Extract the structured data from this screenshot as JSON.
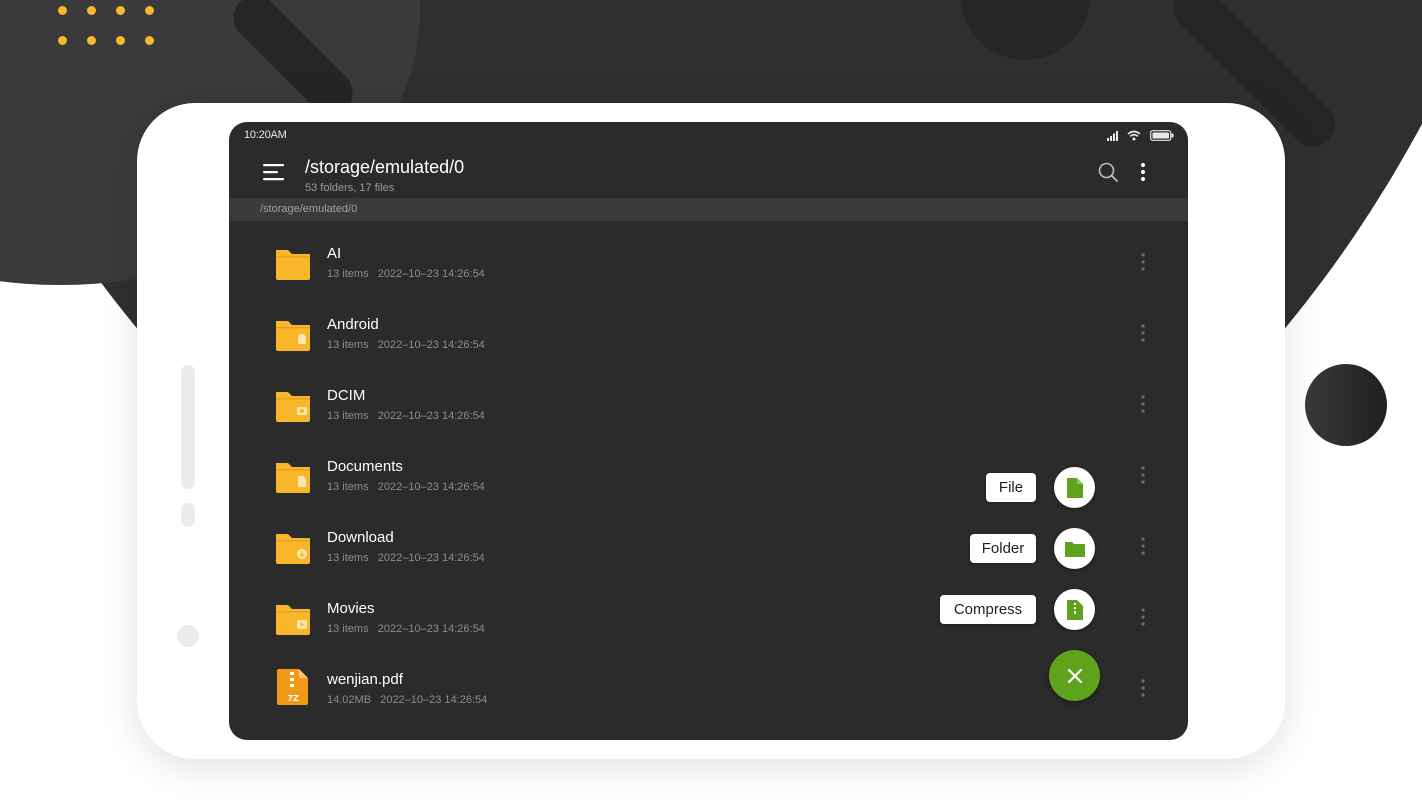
{
  "status_bar": {
    "time": "10:20AM",
    "icons": [
      "signal-icon",
      "wifi-icon",
      "battery-icon"
    ]
  },
  "app_bar": {
    "title": "/storage/emulated/0",
    "subtitle": "53 folders, 17 files",
    "icons": [
      "menu-icon",
      "search-icon",
      "more-vertical-icon"
    ]
  },
  "path_bar": {
    "path": "/storage/emulated/0"
  },
  "files": [
    {
      "name": "AI",
      "count": "13 items",
      "date": "2022–10–23 14:26:54",
      "icon": "folder-icon"
    },
    {
      "name": "Android",
      "count": "13 items",
      "date": "2022–10–23 14:26:54",
      "icon": "folder-android-icon"
    },
    {
      "name": "DCIM",
      "count": "13 items",
      "date": "2022–10–23 14:26:54",
      "icon": "folder-camera-icon"
    },
    {
      "name": "Documents",
      "count": "13 items",
      "date": "2022–10–23 14:26:54",
      "icon": "folder-document-icon"
    },
    {
      "name": "Download",
      "count": "13 items",
      "date": "2022–10–23 14:26:54",
      "icon": "folder-download-icon"
    },
    {
      "name": "Movies",
      "count": "13 items",
      "date": "2022–10–23 14:26:54",
      "icon": "folder-movie-icon"
    },
    {
      "name": "wenjian.pdf",
      "count": "14.02MB",
      "date": "2022–10–23 14:26:54",
      "icon": "archive-7z-icon"
    }
  ],
  "fab_menu": {
    "file_label": "File",
    "folder_label": "Folder",
    "compress_label": "Compress",
    "icons": [
      "new-file-icon",
      "new-folder-icon",
      "compress-icon",
      "close-icon"
    ]
  },
  "colors": {
    "accent": "#5fa31d",
    "folder": "#f8b72a",
    "screen_bg": "#2b2b2b",
    "dots": "#f5b82e"
  }
}
